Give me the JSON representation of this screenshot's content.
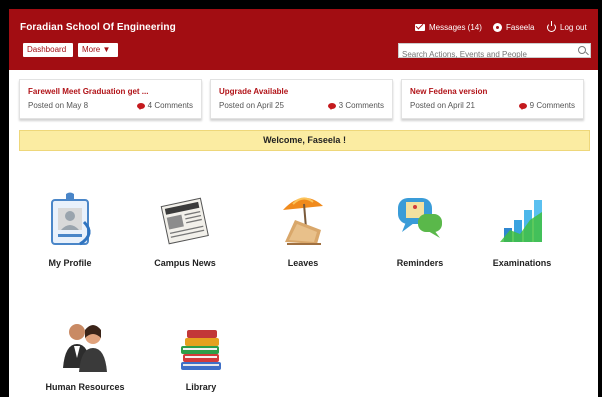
{
  "header": {
    "school_name": "Foradian School Of Engineering",
    "messages_label": "Messages (14)",
    "user_name": "Faseela",
    "logout_label": "Log out",
    "brand_color": "#a20d12"
  },
  "nav": {
    "dashboard_label": "Dashboard",
    "more_label": "More ▼"
  },
  "search": {
    "placeholder": "Search Actions, Events and People"
  },
  "notifications": [
    {
      "title": "Farewell Meet Graduation get ...",
      "posted": "Posted on May 8",
      "comments": "4 Comments"
    },
    {
      "title": "Upgrade Available",
      "posted": "Posted on April 25",
      "comments": "3 Comments"
    },
    {
      "title": "New Fedena version",
      "posted": "Posted on April 21",
      "comments": "9 Comments"
    }
  ],
  "welcome": {
    "text": "Welcome, Faseela !"
  },
  "modules": [
    {
      "label": "My Profile",
      "icon": "id-badge-icon"
    },
    {
      "label": "Campus News",
      "icon": "newspaper-icon"
    },
    {
      "label": "Leaves",
      "icon": "beach-chair-icon"
    },
    {
      "label": "Reminders",
      "icon": "reminder-chat-icon"
    },
    {
      "label": "Examinations",
      "icon": "bar-chart-icon"
    },
    {
      "label": "Human Resources",
      "icon": "people-icon"
    },
    {
      "label": "Library",
      "icon": "books-icon"
    }
  ]
}
